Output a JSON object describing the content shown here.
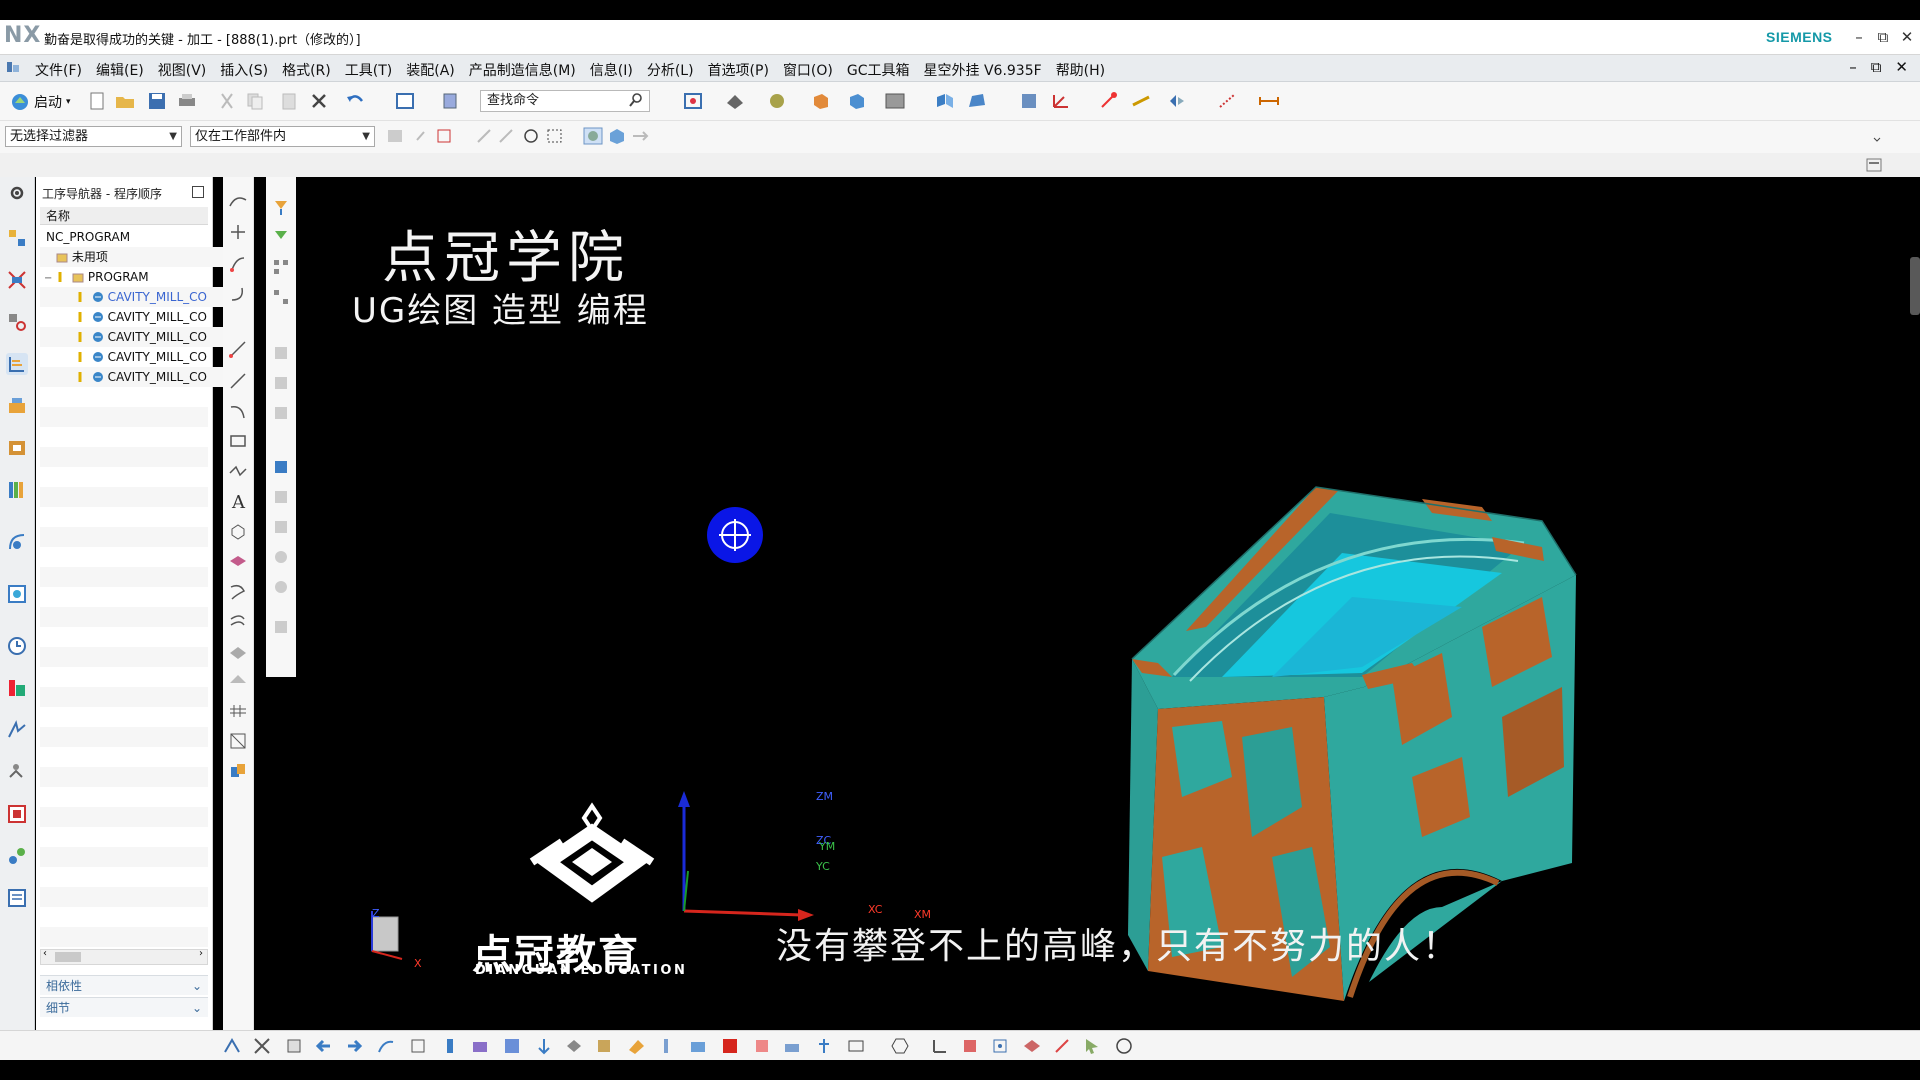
{
  "window": {
    "logo": "NX",
    "title": "勤奋是取得成功的关键 - 加工 - [888(1).prt（修改的）]",
    "brand": "SIEMENS",
    "controls": {
      "minimize": "–",
      "restore": "⧉",
      "close": "✕"
    }
  },
  "menubar": {
    "items": [
      "文件(F)",
      "编辑(E)",
      "视图(V)",
      "插入(S)",
      "格式(R)",
      "工具(T)",
      "装配(A)",
      "产品制造信息(M)",
      "信息(I)",
      "分析(L)",
      "首选项(P)",
      "窗口(O)",
      "GC工具箱",
      "星空外挂 V6.935F",
      "帮助(H)"
    ]
  },
  "toolbar": {
    "start_label": "启动",
    "search_placeholder": "查找命令"
  },
  "filters": {
    "selection_filter": "无选择过滤器",
    "scope": "仅在工作部件内"
  },
  "navigator": {
    "title": "工序导航器 - 程序顺序",
    "column_header": "名称",
    "rows": [
      {
        "label": "NC_PROGRAM",
        "indent": 0
      },
      {
        "label": "未用项",
        "indent": 1
      },
      {
        "label": "PROGRAM",
        "indent": 1
      },
      {
        "label": "CAVITY_MILL_CO",
        "indent": 2,
        "highlight": true
      },
      {
        "label": "CAVITY_MILL_CO",
        "indent": 2
      },
      {
        "label": "CAVITY_MILL_CO",
        "indent": 2
      },
      {
        "label": "CAVITY_MILL_CO",
        "indent": 2
      },
      {
        "label": "CAVITY_MILL_CO",
        "indent": 2
      }
    ],
    "panels": [
      "相依性",
      "细节"
    ]
  },
  "viewport": {
    "brand_title": "点冠学院",
    "brand_subtitle": "UG绘图 造型 编程",
    "slogan": "没有攀登不上的高峰，只有不努力的人！",
    "edu_cn": "点冠教育",
    "edu_en": "DIANGUAN EDUCATION",
    "axes": {
      "zm": "ZM",
      "zc": "ZC",
      "ym": "YM",
      "yc": "YC",
      "xc": "XC",
      "xm": "XM"
    },
    "triad_labels": {
      "z": "Z",
      "x": "X"
    },
    "colors": {
      "teal": "#2fa89e",
      "orange": "#b8642a",
      "cyan": "#16c7de",
      "cursor": "#0a16e6"
    }
  }
}
